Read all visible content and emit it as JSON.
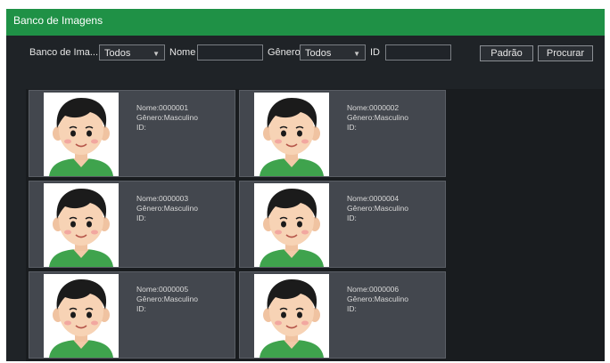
{
  "window": {
    "title": "Banco de Imagens"
  },
  "filters": {
    "banco_label": "Banco de Ima...",
    "banco_value": "Todos",
    "nome_label": "Nome",
    "nome_value": "",
    "genero_label": "Gênero",
    "genero_value": "Todos",
    "id_label": "ID",
    "id_value": "",
    "padrao_button": "Padrão",
    "procurar_button": "Procurar"
  },
  "records": [
    {
      "nome": "Nome:0000001",
      "genero": "Gênero:Masculino",
      "id": "ID:"
    },
    {
      "nome": "Nome:0000002",
      "genero": "Gênero:Masculino",
      "id": "ID:"
    },
    {
      "nome": "Nome:0000003",
      "genero": "Gênero:Masculino",
      "id": "ID:"
    },
    {
      "nome": "Nome:0000004",
      "genero": "Gênero:Masculino",
      "id": "ID:"
    },
    {
      "nome": "Nome:0000005",
      "genero": "Gênero:Masculino",
      "id": "ID:"
    },
    {
      "nome": "Nome:0000006",
      "genero": "Gênero:Masculino",
      "id": "ID:"
    }
  ],
  "colors": {
    "titlebar": "#1f9146",
    "background": "#1f2327",
    "card": "#43474e",
    "shirt": "#3fa34d"
  },
  "icons": {
    "photo": "boy-avatar-icon",
    "dropdown": "chevron-down-icon"
  }
}
